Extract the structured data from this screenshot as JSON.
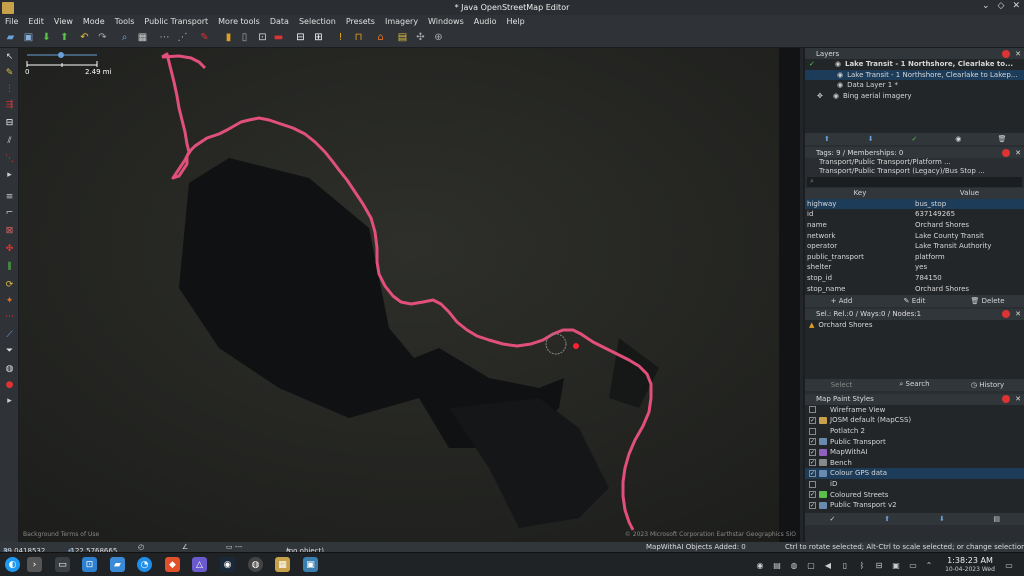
{
  "window": {
    "title": "* Java OpenStreetMap Editor"
  },
  "menu": [
    "File",
    "Edit",
    "View",
    "Mode",
    "Tools",
    "Public Transport",
    "More tools",
    "Data",
    "Selection",
    "Presets",
    "Imagery",
    "Windows",
    "Audio",
    "Help"
  ],
  "map": {
    "scale_start": "0",
    "scale_end": "2.49 mi",
    "attribution_left": "Background Terms of Use",
    "attribution_right": "© 2023 Microsoft Corporation Earthstar Geographics SIO"
  },
  "layers_panel": {
    "title": "Layers",
    "items": [
      {
        "label": "Lake Transit - 1 Northshore, Clearlake to...",
        "bold": true
      },
      {
        "label": "Lake Transit - 1 Northshore, Clearlake to Lakep...",
        "selected": true
      },
      {
        "label": "Data Layer 1 *"
      },
      {
        "label": "Bing aerial imagery"
      }
    ]
  },
  "tags_panel": {
    "title": "Tags: 9 / Memberships: 0",
    "presets": [
      "Transport/Public Transport/Platform ...",
      "Transport/Public Transport (Legacy)/Bus Stop ..."
    ],
    "col_key": "Key",
    "col_value": "Value",
    "rows": [
      {
        "k": "highway",
        "v": "bus_stop"
      },
      {
        "k": "id",
        "v": "637149265"
      },
      {
        "k": "name",
        "v": "Orchard Shores"
      },
      {
        "k": "network",
        "v": "Lake County Transit"
      },
      {
        "k": "operator",
        "v": "Lake Transit Authority"
      },
      {
        "k": "public_transport",
        "v": "platform"
      },
      {
        "k": "shelter",
        "v": "yes"
      },
      {
        "k": "stop_id",
        "v": "784150"
      },
      {
        "k": "stop_name",
        "v": "Orchard Shores"
      }
    ],
    "add": "Add",
    "edit": "Edit",
    "delete": "Delete"
  },
  "selection_panel": {
    "title": "Sel.: Rel.:0 / Ways:0 / Nodes:1",
    "item": "Orchard Shores",
    "select": "Select",
    "search": "Search",
    "history": "History"
  },
  "styles_panel": {
    "title": "Map Paint Styles",
    "items": [
      {
        "label": "Wireframe View",
        "checked": false
      },
      {
        "label": "JOSM default (MapCSS)",
        "checked": true
      },
      {
        "label": "Potlatch 2",
        "checked": false
      },
      {
        "label": "Public Transport",
        "checked": true
      },
      {
        "label": "MapWithAI",
        "checked": true
      },
      {
        "label": "Bench",
        "checked": true
      },
      {
        "label": "Colour GPS data",
        "checked": true,
        "selected": true
      },
      {
        "label": "iD",
        "checked": false
      },
      {
        "label": "Coloured Streets",
        "checked": true
      },
      {
        "label": "Public Transport v2",
        "checked": true
      }
    ]
  },
  "status": {
    "lat": "39.0418532",
    "lon": "-122.5768665",
    "object": "(no object)",
    "mapwithai": "MapWithAI Objects Added: 0",
    "hint": "Ctrl to rotate selected; Alt-Ctrl to scale selected; or change selection"
  },
  "taskbar": {
    "time": "1:38:23 AM",
    "date": "10-04-2023 Wed"
  },
  "colors": {
    "route": "#e0507a",
    "accent": "#1d3c5a"
  }
}
